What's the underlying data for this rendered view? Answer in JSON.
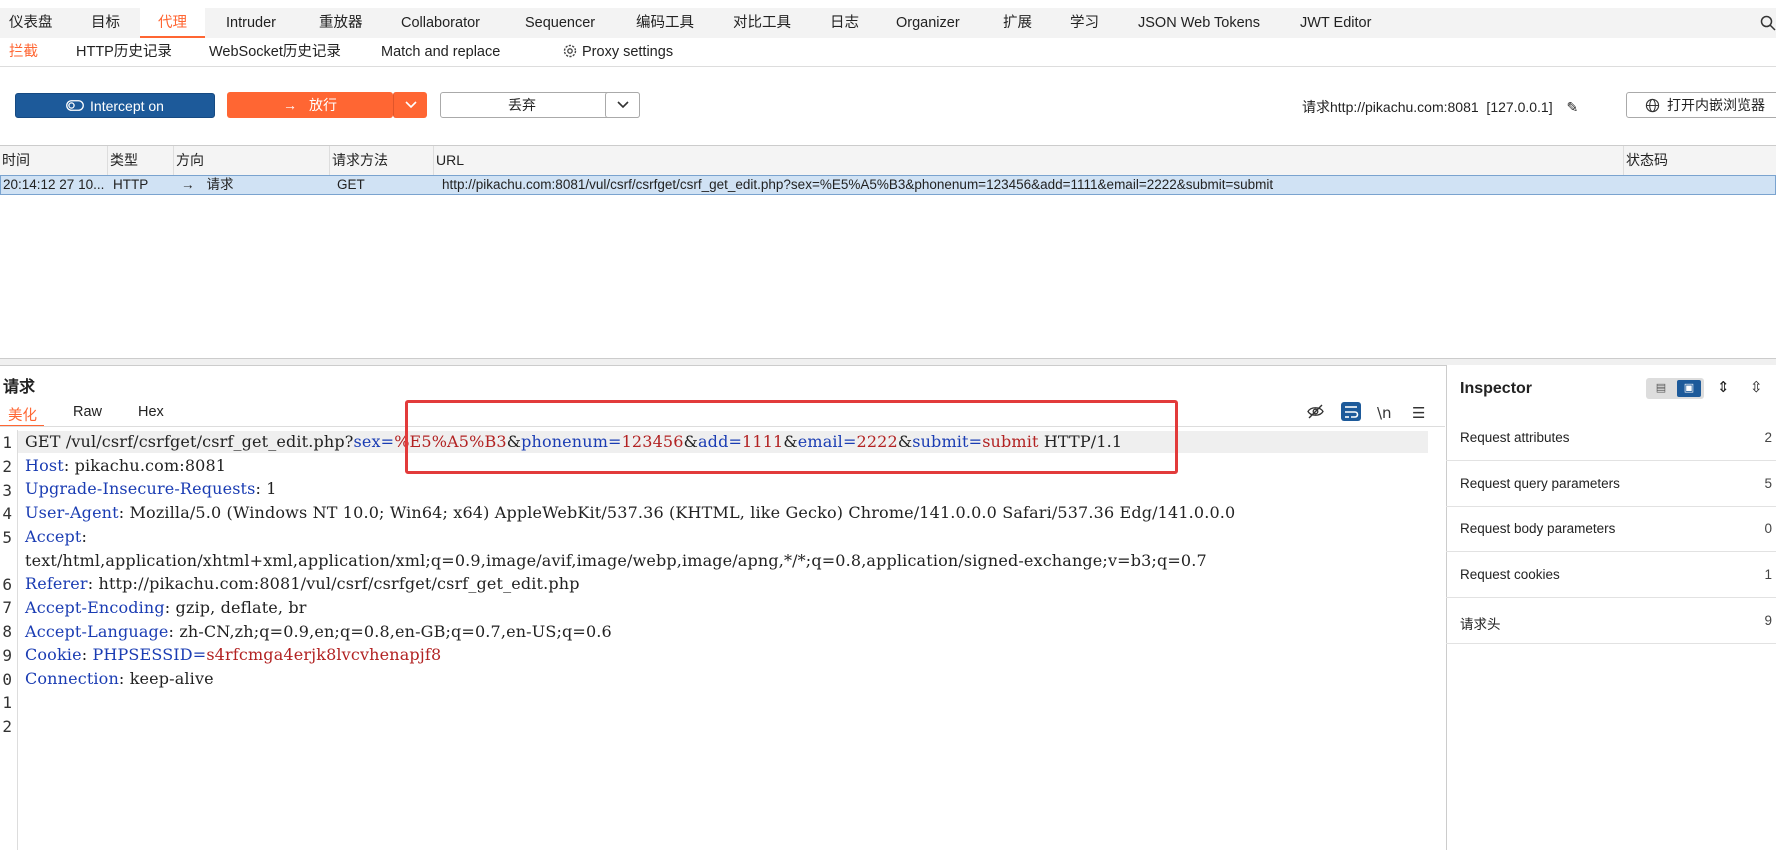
{
  "menu": {
    "items": [
      "仪表盘",
      "目标",
      "代理",
      "Intruder",
      "重放器",
      "Collaborator",
      "Sequencer",
      "编码工具",
      "对比工具",
      "日志",
      "Organizer",
      "扩展",
      "学习",
      "JSON Web Tokens",
      "JWT Editor"
    ],
    "active": "代理"
  },
  "subtabs": {
    "intercept": "拦截",
    "http_history": "HTTP历史记录",
    "ws_history": "WebSocket历史记录",
    "match_replace": "Match and replace",
    "proxy_settings": "Proxy settings"
  },
  "toolbar": {
    "intercept_label": "Intercept on",
    "forward_label": "放行",
    "drop_label": "丢弃",
    "request_info": "请求http://pikachu.com:8081  [127.0.0.1]",
    "open_browser_label": "打开内嵌浏览器"
  },
  "table": {
    "headers": [
      "时间",
      "类型",
      "方向",
      "请求方法",
      "URL",
      "状态码"
    ],
    "row": {
      "time": "20:14:12 27 10...",
      "type": "HTTP",
      "direction": "请求",
      "method": "GET",
      "url": "http://pikachu.com:8081/vul/csrf/csrfget/csrf_get_edit.php?sex=%E5%A5%B3&phonenum=123456&add=1111&email=2222&submit=submit",
      "status": ""
    }
  },
  "request": {
    "title": "请求",
    "view_tabs": [
      "美化",
      "Raw",
      "Hex"
    ],
    "active_view": "美化",
    "line_numbers": [
      "1",
      "2",
      "3",
      "4",
      "5",
      "6",
      "7",
      "8",
      "9",
      "0",
      "1",
      "2"
    ],
    "line1": {
      "prefix": "GET /vul/csrf/csrfget/csrf_get_edit.php?",
      "params": [
        {
          "key": "sex",
          "value": "%E5%A5%B3"
        },
        {
          "key": "phonenum",
          "value": "123456"
        },
        {
          "key": "add",
          "value": "1111"
        },
        {
          "key": "email",
          "value": "2222"
        },
        {
          "key": "submit",
          "value": "submit"
        }
      ],
      "suffix": " HTTP/1.1"
    },
    "headers": [
      {
        "name": "Host",
        "value": " pikachu.com:8081"
      },
      {
        "name": "Upgrade-Insecure-Requests",
        "value": " 1"
      },
      {
        "name": "User-Agent",
        "value": " Mozilla/5.0 (Windows NT 10.0; Win64; x64) AppleWebKit/537.36 (KHTML, like Gecko) Chrome/141.0.0.0 Safari/537.36 Edg/141.0.0.0"
      },
      {
        "name": "Accept",
        "value": ""
      },
      {
        "name": "",
        "value": "text/html,application/xhtml+xml,application/xml;q=0.9,image/avif,image/webp,image/apng,*/*;q=0.8,application/signed-exchange;v=b3;q=0.7"
      },
      {
        "name": "Referer",
        "value": " http://pikachu.com:8081/vul/csrf/csrfget/csrf_get_edit.php"
      },
      {
        "name": "Accept-Encoding",
        "value": " gzip, deflate, br"
      },
      {
        "name": "Accept-Language",
        "value": " zh-CN,zh;q=0.9,en;q=0.8,en-GB;q=0.7,en-US;q=0.6"
      }
    ],
    "cookie": {
      "name": "Cookie",
      "cookie_key": "PHPSESSID",
      "cookie_value": "s4rfcmga4erjk8lvcvhenapjf8"
    },
    "connection": {
      "name": "Connection",
      "value": " keep-alive"
    },
    "newline_toggle": "\\n"
  },
  "inspector": {
    "title": "Inspector",
    "rows": [
      {
        "label": "Request attributes",
        "count": "2"
      },
      {
        "label": "Request query parameters",
        "count": "5"
      },
      {
        "label": "Request body parameters",
        "count": "0"
      },
      {
        "label": "Request cookies",
        "count": "1"
      },
      {
        "label": "请求头",
        "count": "9"
      }
    ]
  },
  "colors": {
    "accent": "#ff6633",
    "intercept": "#1d5a9a",
    "selected_row": "#d0e2f4",
    "highlight_box": "#e23b3b"
  }
}
